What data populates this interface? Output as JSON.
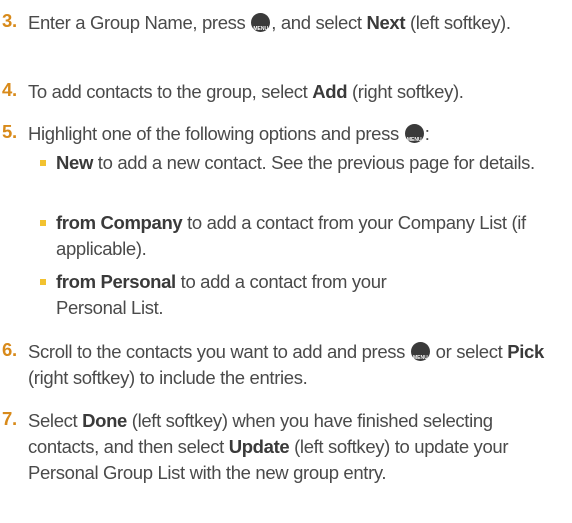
{
  "steps": [
    {
      "num": "3.",
      "pre": "Enter a Group Name, press",
      "mid": ", and select",
      "bold": "Next",
      "post": "(left softkey)."
    },
    {
      "num": "4.",
      "pre": "To add contacts to the group, select",
      "bold": "Add",
      "post": "(right softkey)."
    },
    {
      "num": "5.",
      "pre": "Highlight one of the following options and press",
      "post": ":"
    },
    {
      "num": "6.",
      "pre": "Scroll to the contacts you want to add and press",
      "mid": "or select",
      "bold": "Pick",
      "post": "(right softkey) to include the entries."
    },
    {
      "num": "7.",
      "pre": "Select",
      "bold": "Done",
      "mid": "(left softkey) when you have finished selecting contacts, and then select",
      "bold2": "Update",
      "post": "(left softkey) to update your Personal Group List with the new group entry."
    }
  ],
  "bullets": [
    {
      "bold": "New",
      "text": "to add a new contact. See the previous page for details."
    },
    {
      "bold": "from Company",
      "text": "to add a contact from your Company List (if applicable)."
    },
    {
      "bold": "from Personal",
      "text": "to add a contact from your Personal List."
    }
  ],
  "icons": {
    "menu_ok_key": "menu-ok-key-icon"
  },
  "colors": {
    "number": "#d88a1a",
    "bullet": "#f2c230",
    "text": "#4a4a4a"
  }
}
